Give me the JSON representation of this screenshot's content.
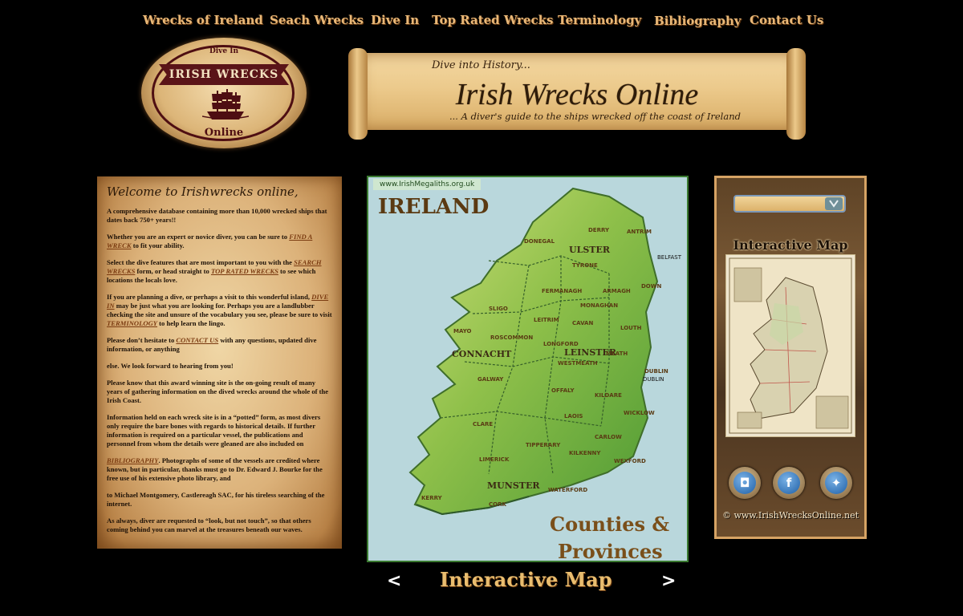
{
  "nav": {
    "items": [
      {
        "label": "Wrecks of Ireland"
      },
      {
        "label": "Seach Wrecks"
      },
      {
        "label": "Dive In"
      },
      {
        "label": "Top Rated Wrecks"
      },
      {
        "label": "Terminology"
      },
      {
        "label": "Bibliography"
      },
      {
        "label": "Contact Us"
      }
    ]
  },
  "logo": {
    "top": "Dive In",
    "banner": "IRISH WRECKS",
    "bottom": "Online"
  },
  "header": {
    "pre": "Dive into History...",
    "title": "Irish Wrecks Online",
    "subtitle": "... A diver's guide to the ships wrecked off the coast of Ireland"
  },
  "welcome": {
    "title": "Welcome to Irishwrecks online,",
    "p1": "A comprehensive database containing more than 10,000 wrecked ships that dates back 750+ years!!",
    "p2_pre": "Whether you are an expert or novice diver, you can be sure to ",
    "p2_link": "FIND A WRECK",
    "p2_post": " to fit your ability.",
    "p3_pre": "Select the dive features that are most important to you with the ",
    "p3_link1": "SEARCH WRECKS",
    "p3_mid": " form, or head straight to ",
    "p3_link2": "TOP RATED WRECKS",
    "p3_post": " to see which locations the locals love.",
    "p4_pre": "If you are planning a dive, or perhaps a visit to this wonderful island, ",
    "p4_link1": "DIVE IN",
    "p4_mid": " may be just what you are looking for. Perhaps you are a landlubber checking the site and unsure of the vocabulary you see, please be sure to visit ",
    "p4_link2": "TERMINOLOGY",
    "p4_post": " to help learn the lingo.",
    "p5_pre": "Please don’t hesitate to ",
    "p5_link": "CONTACT US",
    "p5_post": " with any questions, updated dive information, or anything",
    "p6": "else. We look forward to hearing from you!",
    "p7": "Please know that this award winning site is the on-going result of many years of gathering information on the dived wrecks around the whole of the Irish Coast.",
    "p8": "Information held on each wreck site is in a “potted” form, as most divers only require the bare bones with regards to historical details.  If further information is required on a particular vessel, the publications and personnel from whom the details were gleaned are also included on",
    "p9_link": "BIBLIOGRAPHY",
    "p9_post": ".  Photographs of some of the vessels are credited where known, but in particular, thanks must go to Dr. Edward J. Bourke for the free use of his extensive photo library, and",
    "p10": " to Michael Montgomery, Castlereagh SAC, for his tireless searching of the internet.",
    "p11": "As always, diver are requested to “look, but not touch”, so that others coming behind you can marvel at the treasures beneath our waves."
  },
  "map": {
    "watermark": "www.IrishMegaliths.org.uk",
    "country": "IRELAND",
    "caption1": "Counties &",
    "caption2": "Provinces",
    "provinces": [
      "ULSTER",
      "CONNACHT",
      "LEINSTER",
      "MUNSTER"
    ],
    "counties": [
      "DERRY",
      "ANTRIM",
      "DONEGAL",
      "TYRONE",
      "FERMANAGH",
      "ARMAGH",
      "DOWN",
      "MONAGHAN",
      "SLIGO",
      "LEITRIM",
      "CAVAN",
      "LOUTH",
      "MAYO",
      "ROSCOMMON",
      "LONGFORD",
      "MEATH",
      "WESTMEATH",
      "DUBLIN",
      "GALWAY",
      "OFFALY",
      "KILDARE",
      "WICKLOW",
      "LAOIS",
      "CLARE",
      "CARLOW",
      "TIPPERARY",
      "KILKENNY",
      "WEXFORD",
      "LIMERICK",
      "WATERFORD",
      "KERRY",
      "CORK"
    ],
    "cities": [
      "BELFAST",
      "DUBLIN"
    ]
  },
  "carousel": {
    "title": "Interactive Map",
    "prev": "<",
    "next": ">"
  },
  "side": {
    "search_placeholder": "",
    "map_title": "Interactive Map",
    "copyright": "© www.IrishWrecksOnline.net",
    "social": [
      "instagram-icon",
      "facebook-icon",
      "twitter-icon"
    ]
  }
}
